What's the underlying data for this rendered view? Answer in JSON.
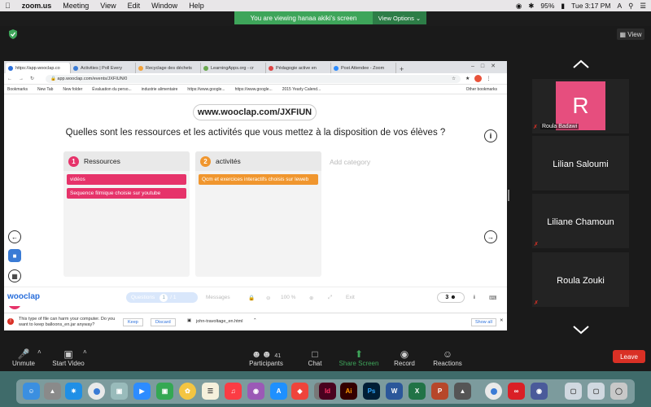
{
  "menubar": {
    "app": "zoom.us",
    "items": [
      "Meeting",
      "View",
      "Edit",
      "Window",
      "Help"
    ],
    "battery": "95%",
    "clock": "Tue 3:17 PM",
    "input_source": "A"
  },
  "banner": {
    "viewing": "You are viewing hanaa akiki's screen",
    "view_options": "View Options"
  },
  "zoom": {
    "view_label": "View"
  },
  "browser": {
    "tabs": [
      {
        "label": "https://app.wooclap.co",
        "color": "#2a6fdb"
      },
      {
        "label": "Activities | Poll Every",
        "color": "#3a7bd5"
      },
      {
        "label": "Recyclage des déchets",
        "color": "#f2a23a"
      },
      {
        "label": "LearningApps.org - cr",
        "color": "#6aa84f"
      },
      {
        "label": "Pédagogie active en",
        "color": "#d44"
      },
      {
        "label": "Post Attendee - Zoom",
        "color": "#2d8cff"
      }
    ],
    "url": "app.wooclap.com/events/JXFIUN/0",
    "bookmarks": [
      "Bookmarks",
      "New Tab",
      "New folder",
      "Évaluation du perso...",
      "industrie alimentaire",
      "https://www.google...",
      "https://www.google...",
      "2015 Yearly Calend...",
      "Other bookmarks"
    ],
    "download": {
      "warning": "This type of file can harm your computer. Do you want to keep balloons_en.jar anyway?",
      "keep": "Keep",
      "discard": "Discard",
      "file": "john-travoltage_en.html",
      "show_all": "Show all"
    }
  },
  "wooclap": {
    "code": "www.wooclap.com/JXFIUN",
    "question": "Quelles sont les ressources et les activités que vous mettez à la disposition de vos élèves ?",
    "categories": [
      {
        "num": "1",
        "title": "Ressources",
        "cards": [
          "vidéos",
          "Sequence filmique choisie sur youtube"
        ],
        "color": "#e6336a"
      },
      {
        "num": "2",
        "title": "activités",
        "cards": [
          "Qcm et exercices interactifs choisis sur leweb"
        ],
        "color": "#f0962e"
      }
    ],
    "add_category": "Add category",
    "footer": {
      "logo": "wooclap",
      "questions": "Questions",
      "page": "1",
      "page_total": "/ 1",
      "messages": "Messages",
      "zoom": "100 %",
      "exit": "Exit",
      "participants": "3"
    }
  },
  "participants": [
    {
      "name": "Roula Badawi",
      "initial": "R"
    },
    {
      "name": "Lilian Saloumi"
    },
    {
      "name": "Liliane Chamoun"
    },
    {
      "name": "Roula Zouki"
    }
  ],
  "toolbar": {
    "unmute": "Unmute",
    "start_video": "Start Video",
    "participants": "Participants",
    "participants_count": "41",
    "chat": "Chat",
    "share_screen": "Share Screen",
    "record": "Record",
    "reactions": "Reactions",
    "leave": "Leave"
  },
  "dock": {
    "apps": [
      {
        "label": "Id",
        "color": "#49021f"
      },
      {
        "label": "Ai",
        "color": "#330000"
      },
      {
        "label": "Ps",
        "color": "#001e36"
      },
      {
        "label": "W",
        "color": "#2b579a"
      },
      {
        "label": "X",
        "color": "#217346"
      },
      {
        "label": "P",
        "color": "#b7472a"
      }
    ]
  }
}
